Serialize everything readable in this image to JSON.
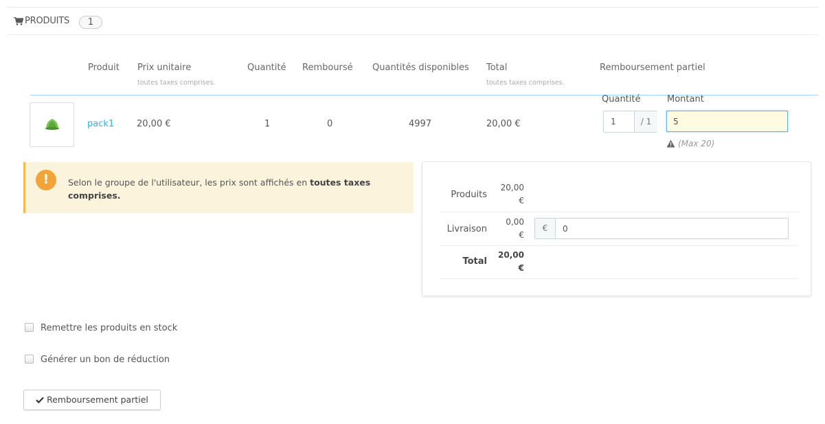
{
  "panel": {
    "heading": "Produits",
    "count": "1"
  },
  "table": {
    "headers": {
      "product": "Produit",
      "unit_price": "Prix unitaire",
      "unit_price_sub": "toutes taxes comprises.",
      "quantity": "Quantité",
      "refunded": "Remboursé",
      "available": "Quantités disponibles",
      "total": "Total",
      "total_sub": "toutes taxes comprises.",
      "partial_refund": "Remboursement partiel"
    },
    "row": {
      "product_name": "pack1",
      "unit_price": "20,00 €",
      "quantity": "1",
      "refunded": "0",
      "available": "4997",
      "total": "20,00 €"
    },
    "refund": {
      "quantity_label": "Quantité",
      "amount_label": "Montant",
      "quantity_value": "1",
      "quantity_max": "/ 1",
      "amount_value": "5",
      "max_note": "(Max 20)"
    }
  },
  "alert": {
    "text_before": "Selon le groupe de l'utilisateur, les prix sont affichés en ",
    "text_bold": "toutes taxes comprises.",
    "icon": "exclamation-icon",
    "color": "#f1a43a"
  },
  "totals": {
    "products_label": "Produits",
    "products_value_amount": "20,00",
    "products_value_currency": "€",
    "shipping_label": "Livraison",
    "shipping_value_amount": "0,00",
    "shipping_value_currency": "€",
    "shipping_currency_addon": "€",
    "shipping_input_value": "0",
    "total_label": "Total",
    "total_value_amount": "20,00",
    "total_value_currency": "€"
  },
  "options": {
    "restock_label": "Remettre les produits en stock",
    "voucher_label": "Générer un bon de réduction"
  },
  "submit": {
    "label": "Remboursement partiel"
  },
  "colors": {
    "link": "#25b9d7",
    "header_line": "#a9d6f5",
    "alert_bg": "#fcf3dd",
    "focus_input_bg": "#fefbe1"
  }
}
